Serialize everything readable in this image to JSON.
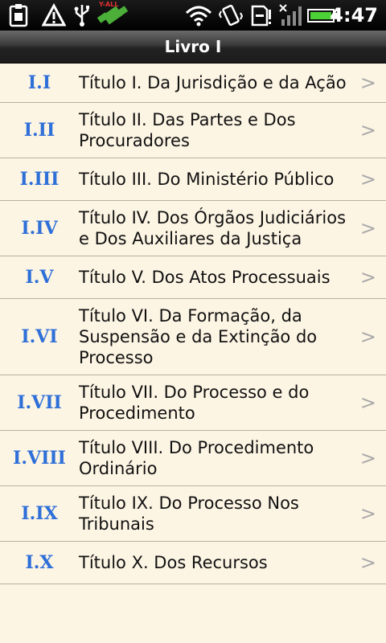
{
  "status_bar": {
    "time": "4:47",
    "icons": [
      "clipboard-icon",
      "warning-icon",
      "usb-icon",
      "gps-icon",
      "wifi-icon",
      "vibrate-icon",
      "sd-card-icon",
      "signal-icon",
      "battery-icon"
    ],
    "gps_badge": "Y-ALL"
  },
  "header": {
    "title": "Livro I"
  },
  "items": [
    {
      "num": "I.I",
      "label": "Título I. Da Jurisdição e da Ação"
    },
    {
      "num": "I.II",
      "label": "Título II. Das Partes e Dos Procuradores"
    },
    {
      "num": "I.III",
      "label": "Título III. Do Ministério Público"
    },
    {
      "num": "I.IV",
      "label": "Título IV. Dos Órgãos Judiciários e Dos Auxiliares da Justiça"
    },
    {
      "num": "I.V",
      "label": "Título V. Dos Atos Processuais"
    },
    {
      "num": "I.VI",
      "label": "Título VI. Da Formação, da Suspensão e da Extinção do Processo"
    },
    {
      "num": "I.VII",
      "label": "Título VII. Do Processo e do Procedimento"
    },
    {
      "num": "I.VIII",
      "label": "Título VIII. Do Procedimento Ordinário"
    },
    {
      "num": "I.IX",
      "label": "Título IX. Do Processo Nos Tribunais"
    },
    {
      "num": "I.X",
      "label": "Título X. Dos Recursos"
    }
  ],
  "chevron": ">",
  "colors": {
    "background": "#fdf5e4",
    "number": "#2e6fd8",
    "divider": "#b8b0a0",
    "chevron": "#a9a9a9"
  }
}
